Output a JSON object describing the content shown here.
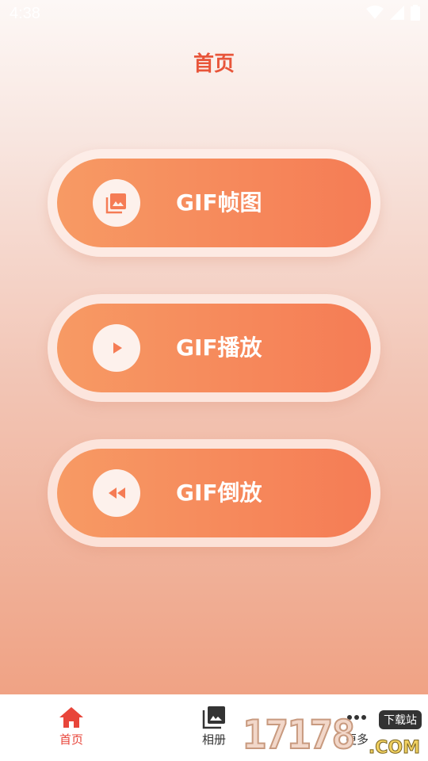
{
  "status_bar": {
    "time": "4:38"
  },
  "page": {
    "title": "首页"
  },
  "menu": [
    {
      "label": "GIF帧图",
      "icon": "photo-album-icon"
    },
    {
      "label": "GIF播放",
      "icon": "play-icon"
    },
    {
      "label": "GIF倒放",
      "icon": "rewind-icon"
    }
  ],
  "bottom_nav": {
    "items": [
      {
        "label": "首页",
        "icon": "home-icon",
        "active": true
      },
      {
        "label": "相册",
        "icon": "photo-album-icon",
        "active": false
      },
      {
        "label": "更多",
        "icon": "more-icon",
        "active": false
      }
    ]
  },
  "watermark": {
    "digits": "17178",
    "tag": "下载站",
    "suffix": ".COM"
  },
  "colors": {
    "accent": "#e8553a",
    "button_start": "#f79a64",
    "button_end": "#f57c55",
    "nav_active": "#e8453a"
  }
}
